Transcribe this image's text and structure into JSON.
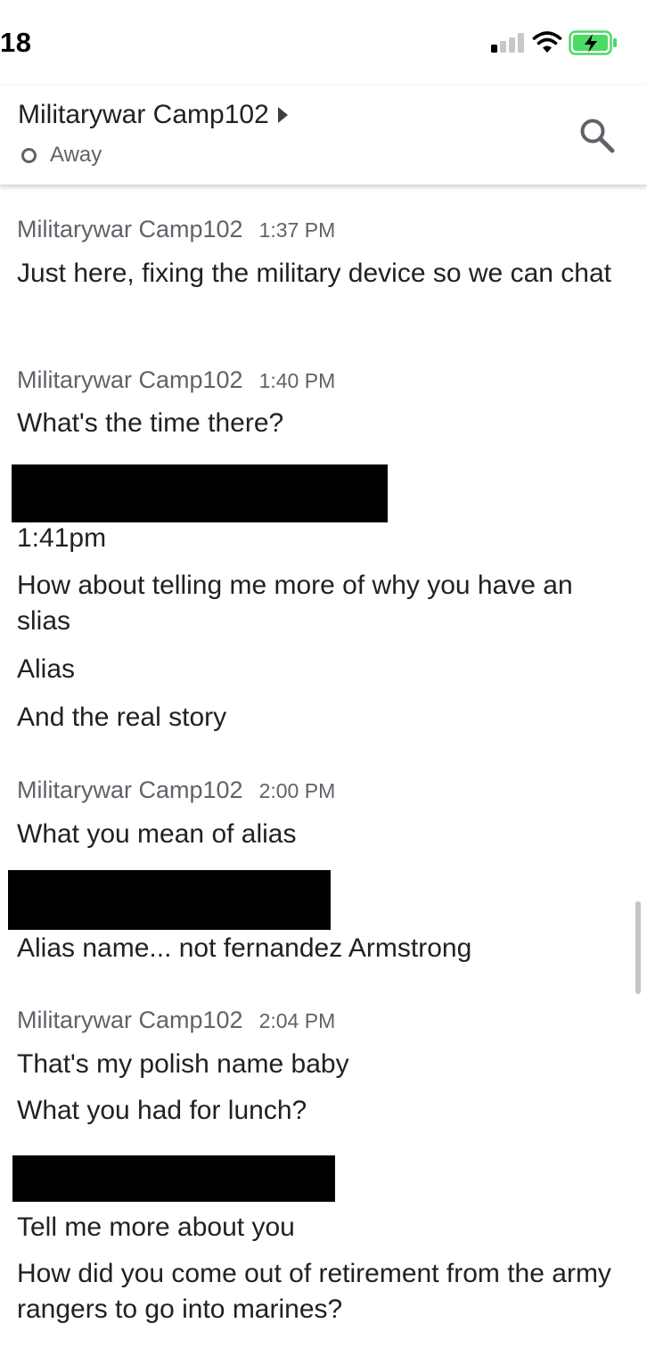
{
  "status_bar": {
    "time": "18",
    "signal_bars_active": 1,
    "signal_bars_total": 4,
    "wifi_icon": "wifi-icon",
    "battery_icon": "battery-charging-icon",
    "battery_color": "#4cd964"
  },
  "header": {
    "title": "Militarywar Camp102",
    "presence": "Away",
    "caret_icon": "caret-right-icon",
    "search_icon": "search-icon"
  },
  "messages": [
    {
      "sender": "Militarywar Camp102",
      "time": "1:37 PM",
      "lines": [
        "Just here, fixing the military device so we can chat"
      ]
    },
    {
      "sender": "Militarywar Camp102",
      "time": "1:40 PM",
      "lines": [
        "What's the time there?"
      ]
    },
    {
      "sender": "[redacted]",
      "time": "",
      "lines": [
        "1:41pm",
        "How about telling me more of why you have an slias",
        "Alias",
        "And the real story"
      ]
    },
    {
      "sender": "Militarywar Camp102",
      "time": "2:00 PM",
      "lines": [
        "What you mean of alias"
      ]
    },
    {
      "sender": "[redacted]",
      "time": "",
      "lines": [
        "Alias name... not fernandez Armstrong"
      ]
    },
    {
      "sender": "Militarywar Camp102",
      "time": "2:04 PM",
      "lines": [
        "That's my polish name baby",
        "What you had for lunch?"
      ]
    },
    {
      "sender": "[redacted]",
      "time": "",
      "lines": [
        "Tell me more about you",
        "How did you come out of retirement from the army rangers to go into marines?"
      ]
    }
  ],
  "colors": {
    "text": "#202124",
    "secondary_text": "#5f6368",
    "redaction": "#000000"
  }
}
